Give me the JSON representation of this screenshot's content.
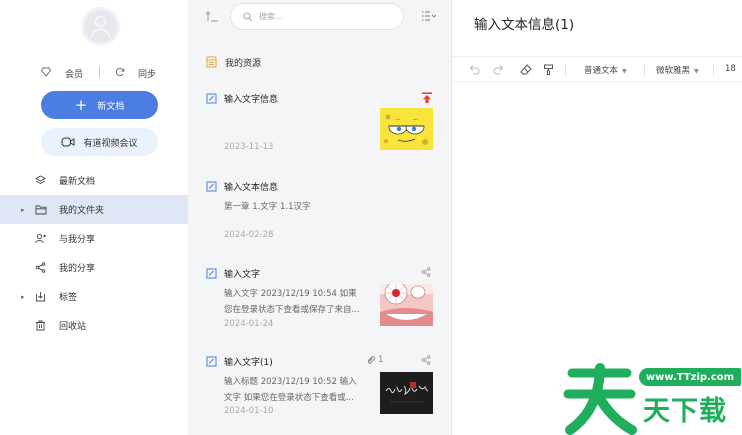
{
  "sidebar": {
    "member_label": "会员",
    "sync_label": "同步",
    "new_doc_label": "新文档",
    "meeting_label": "有道视频会议",
    "nav": [
      {
        "label": "最新文档",
        "active": false,
        "has_arrow": false
      },
      {
        "label": "我的文件夹",
        "active": true,
        "has_arrow": true
      },
      {
        "label": "与我分享",
        "active": false,
        "has_arrow": false
      },
      {
        "label": "我的分享",
        "active": false,
        "has_arrow": false
      },
      {
        "label": "标签",
        "active": false,
        "has_arrow": true
      },
      {
        "label": "回收站",
        "active": false,
        "has_arrow": false
      }
    ]
  },
  "list": {
    "search_placeholder": "搜索...",
    "folder_label": "我的资源",
    "notes": [
      {
        "title": "输入文字信息",
        "snippet": "",
        "date": "2023-11-13",
        "corner_icon": "pin-top-icon"
      },
      {
        "title": "输入文本信息",
        "snippet": "第一章 1.文字 1.1汉字",
        "date": "2024-02-28",
        "corner_icon": ""
      },
      {
        "title": "输入文字",
        "snippet": "输入文字 2023/12/19 10:54 如果您在登录状态下查看或保存了来自...",
        "date": "2024-01-24",
        "corner_icon": "share-icon"
      },
      {
        "title": "输入文字(1)",
        "snippet": "输入标题 2023/12/19 10:52 输入文字 如果您在登录状态下查看或...",
        "date": "2024-01-10",
        "corner_icon": "share-icon",
        "attachment_count": "1"
      }
    ]
  },
  "editor": {
    "title": "输入文本信息(1)",
    "toolbar": {
      "paragraph_style": "普通文本",
      "font_family": "微软雅黑",
      "font_size": "18"
    }
  },
  "watermark": {
    "url": "www.TTzip.com",
    "brand": "天下载"
  },
  "colors": {
    "accent": "#4b7de3",
    "active_nav_bg": "#dfe7f5",
    "list_bg": "#f4f5f7",
    "pin_red": "#e8413b",
    "watermark_green": "#1fae5b"
  }
}
